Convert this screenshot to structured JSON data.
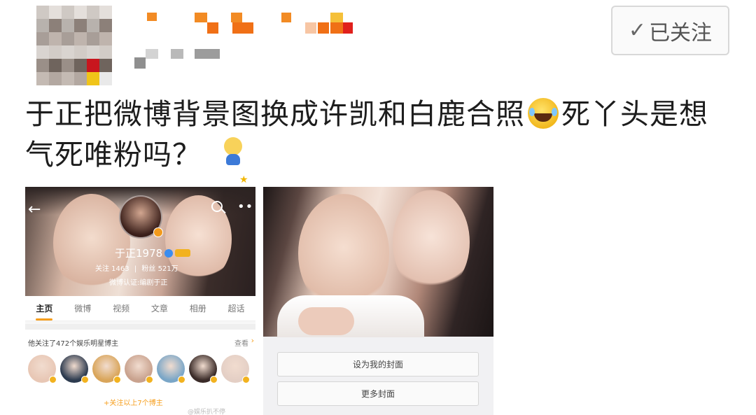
{
  "header": {
    "follow_button_label": "已关注",
    "check_glyph": "✓"
  },
  "post": {
    "text_part1": "于正把微博背景图换成许凯和白鹿合照",
    "emoji1": "laugh-cry-icon",
    "text_part2": "死丫头是想气死唯粉吗？",
    "emoji2": "doge-sit-icon"
  },
  "left_image": {
    "profile_name": "于正1978",
    "stats": [
      "关注 1463",
      "粉丝 521万"
    ],
    "description": "微博认证:编剧于正",
    "tabs": [
      "主页",
      "微博",
      "视频",
      "文章",
      "相册",
      "超话"
    ],
    "active_tab": 0,
    "follow_text": "他关注了472个娱乐明星博主",
    "view_label": "查看",
    "follow_all_label": "+关注以上7个博主",
    "watermark": "@娱乐扒不停"
  },
  "right_image": {
    "set_cover_label": "设为我的封面",
    "more_covers_label": "更多封面"
  },
  "colors": {
    "accent": "#f69e1c",
    "text": "#1d1d1d",
    "button_border": "#d8d8d8"
  }
}
